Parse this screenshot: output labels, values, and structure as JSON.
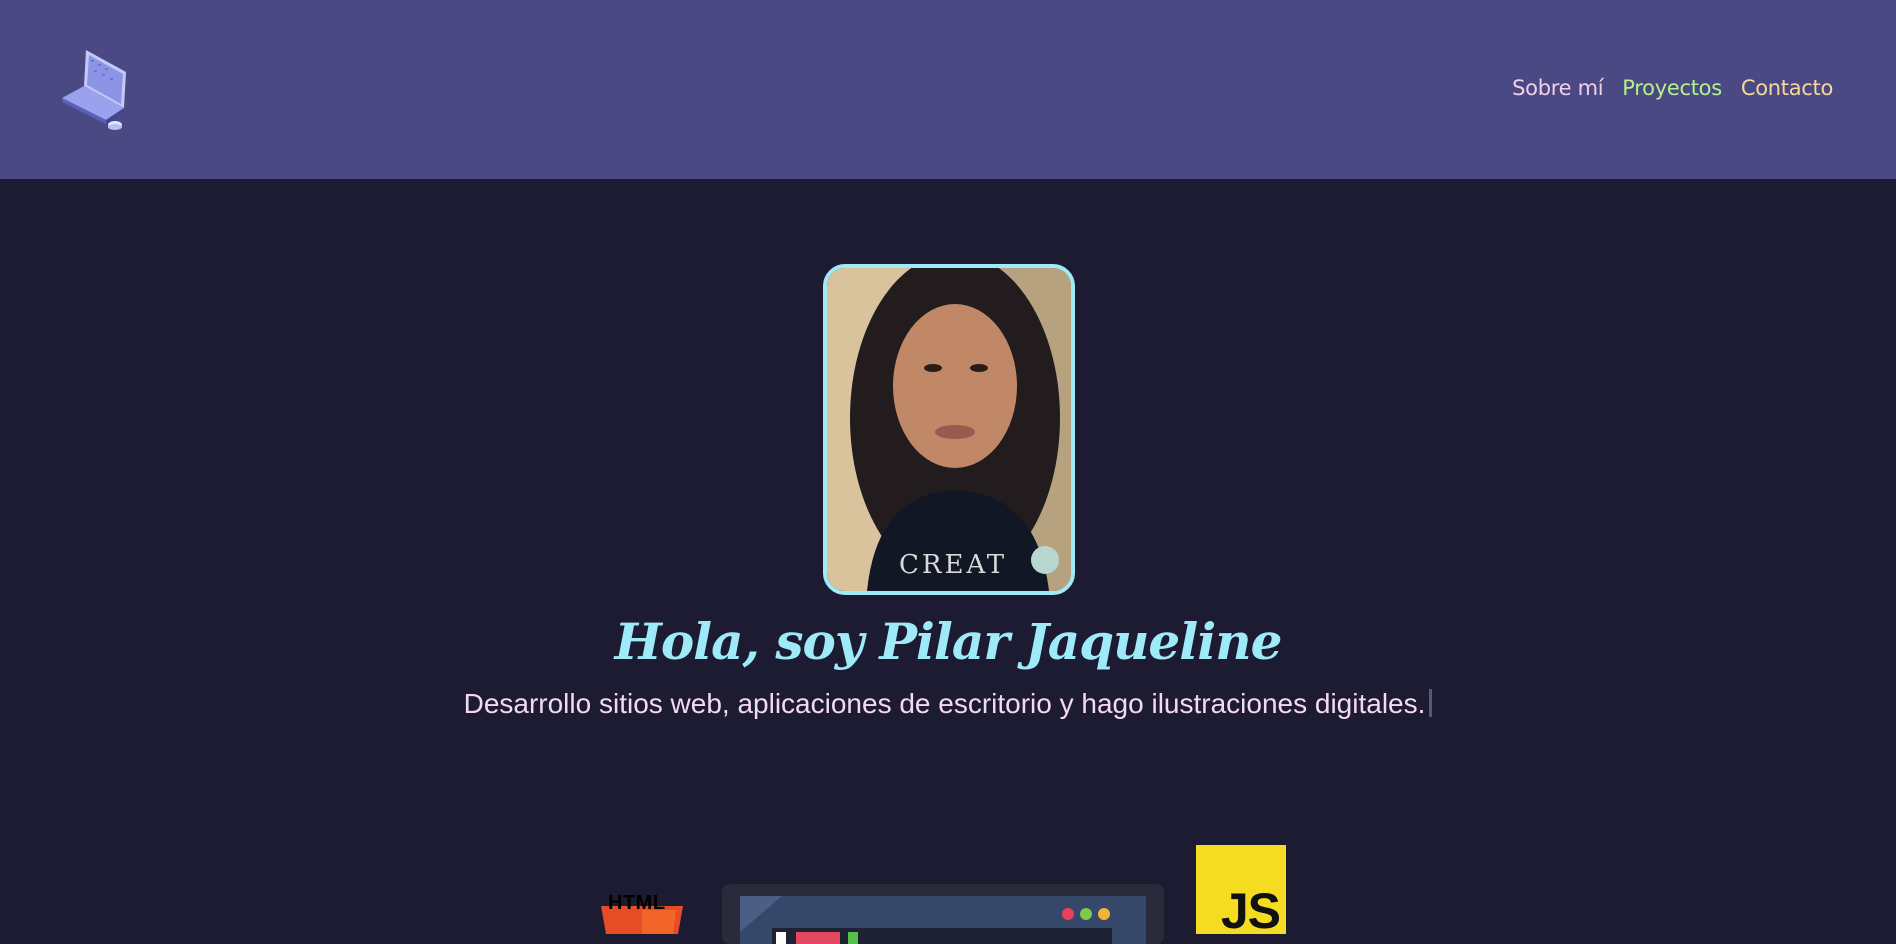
{
  "header": {
    "logo_icon": "laptop-icon",
    "nav": [
      {
        "label": "Sobre mí",
        "color": "#f2cfe6"
      },
      {
        "label": "Proyectos",
        "color": "#b4f08c"
      },
      {
        "label": "Contacto",
        "color": "#f6d79c"
      }
    ]
  },
  "hero": {
    "photo": "profile-photo",
    "greeting": "Hola, soy Pilar Jaqueline",
    "tagline": "Desarrollo sitios web, aplicaciones de escritorio y hago ilustraciones digitales."
  },
  "tech": {
    "html_label": "HTML",
    "js_label": "JS"
  },
  "colors": {
    "header_bg": "#4a4983",
    "page_bg": "#1c1b32",
    "accent": "#9eeaf9"
  }
}
